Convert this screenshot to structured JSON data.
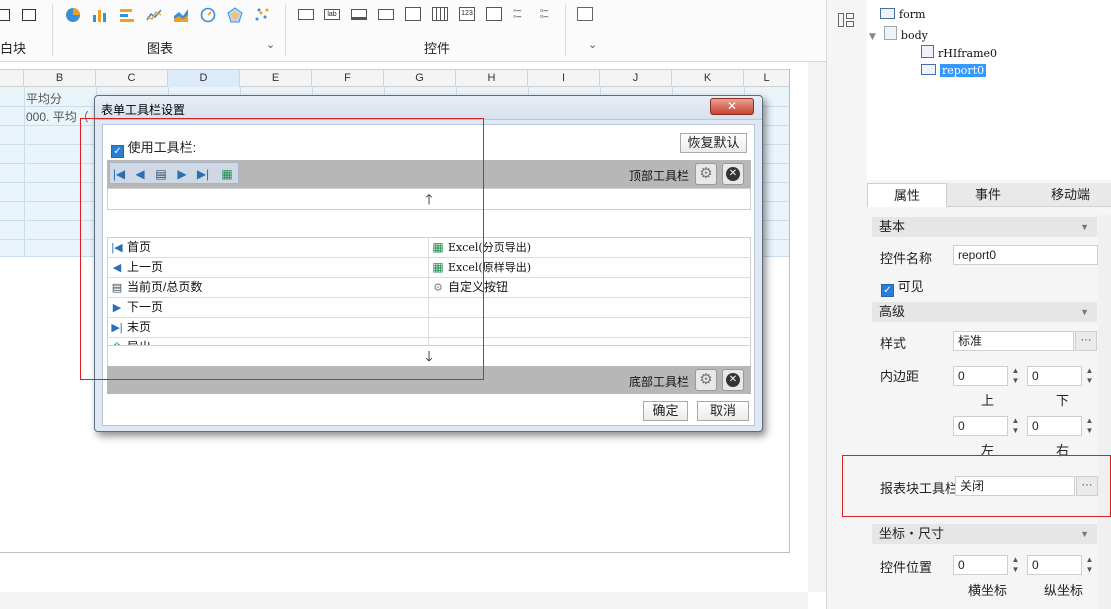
{
  "ribbon": {
    "group1_label": "白块",
    "group2_label": "图表",
    "group3_label": "控件"
  },
  "sheet": {
    "columns": [
      "B",
      "C",
      "D",
      "E",
      "F",
      "G",
      "H",
      "I",
      "J",
      "K",
      "L"
    ],
    "selected_column": "D",
    "cell_b1": "平均分",
    "cell_b2": "000. 平均（"
  },
  "tree": {
    "form": "form",
    "body": "body",
    "frame": "rHIframe0",
    "report": "report0"
  },
  "panel": {
    "tabs": [
      "属性",
      "事件",
      "移动端"
    ],
    "active_tab": "属性",
    "section_basic": "基本",
    "control_name_label": "控件名称",
    "control_name_value": "report0",
    "visible_label": "可见",
    "visible_checked": true,
    "section_advanced": "高级",
    "style_label": "样式",
    "style_value": "标准",
    "padding_label": "内边距",
    "padding_top": "0",
    "padding_bottom": "0",
    "padding_left": "0",
    "padding_right": "0",
    "label_top": "上",
    "label_bottom": "下",
    "label_left": "左",
    "label_right": "右",
    "toolbar_label": "报表块工具栏",
    "toolbar_value": "关闭",
    "ellipsis": "···",
    "section_coords": "坐标・尺寸",
    "position_label": "控件位置",
    "pos_x": "0",
    "pos_y": "0",
    "x_label": "横坐标",
    "y_label": "纵坐标"
  },
  "dialog": {
    "title": "表单工具栏设置",
    "close": "✕",
    "use_toolbar_label": "使用工具栏:",
    "use_toolbar_checked": true,
    "restore_default": "恢复默认",
    "top_toolbar_label": "顶部工具栏",
    "bottom_toolbar_label": "底部工具栏",
    "up_arrow": "🡑",
    "down_arrow": "🡓",
    "left_items": [
      "首页",
      "上一页",
      "当前页/总页数",
      "下一页",
      "末页",
      "导出"
    ],
    "right_items": [
      "Excel(分页导出)",
      "Excel(原样导出)",
      "自定义按钮"
    ],
    "ok": "确定",
    "cancel": "取消"
  },
  "colors": {
    "accent": "#3399ff",
    "highlight_red": "#e02020",
    "dialog_close": "#c7432f",
    "grid_fill": "#eaf4fb"
  }
}
